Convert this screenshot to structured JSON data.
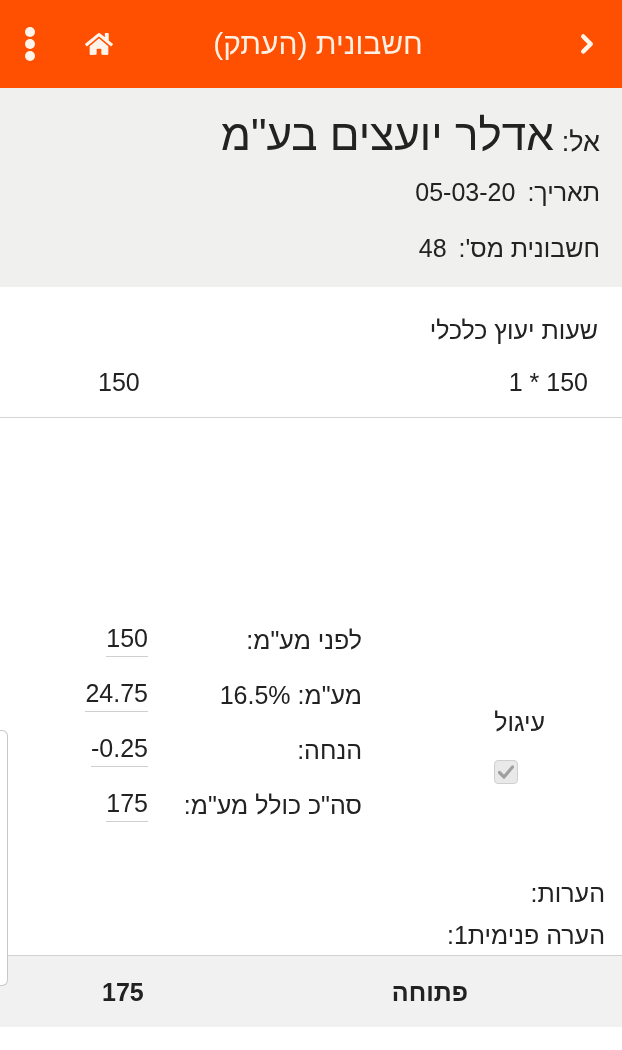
{
  "header": {
    "title": "חשבונית (העתק)"
  },
  "invoice": {
    "to_label": "אל:",
    "to_name": "אדלר יועצים בע\"מ",
    "fields": [
      {
        "label": "תאריך:",
        "value": "05-03-20"
      },
      {
        "label": "חשבונית מס':",
        "value": "48"
      }
    ]
  },
  "line_items": [
    {
      "description": "שעות יעוץ כלכלי",
      "quantity_price": "1 * 150",
      "amount": "150"
    }
  ],
  "rounding": {
    "label": "עיגול",
    "checked": true,
    "disabled": true
  },
  "totals": [
    {
      "label": "לפני מע\"מ:",
      "value": "150"
    },
    {
      "label": "מע\"מ: 16.5%",
      "value": "24.75"
    },
    {
      "label": "הנחה:",
      "value": "-0.25"
    },
    {
      "label": "סה\"כ כולל מע\"מ:",
      "value": "175"
    }
  ],
  "notes": [
    {
      "label": "הערות:"
    },
    {
      "label": "הערה פנימית1:"
    }
  ],
  "footer": {
    "status": "פתוחה",
    "total": "175"
  }
}
